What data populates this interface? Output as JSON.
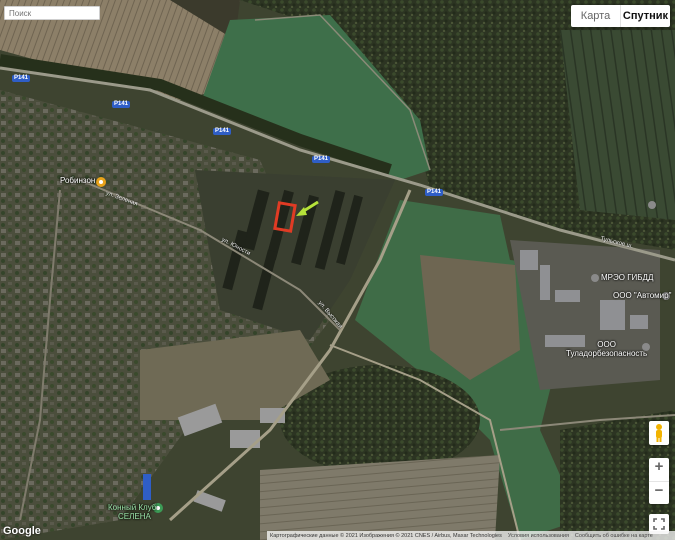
{
  "search": {
    "placeholder": "Поиск"
  },
  "map_type": {
    "map_label": "Карта",
    "satellite_label": "Спутник",
    "selected": "satellite"
  },
  "places": {
    "robinzon": "Робинзон",
    "mrez": "МРЭО ГИБДД",
    "avtomir": "ООО \"Автомир\"",
    "tula": "ООО\nТуладорбезопасность",
    "konny1": "Конный Клуб",
    "konny2": "СЕЛЕНА"
  },
  "roads": {
    "p141": "P141",
    "tulskoe": "Тульское ш.",
    "zelenaya": "ул. Зеленая",
    "yunosti": "ул. Юности",
    "vysokaya": "ул. Высокая"
  },
  "footer": {
    "attribution": "Картографические данные © 2021 Изображения © 2021 CNES / Airbus, Maxar Technologies",
    "terms": "Условия использования",
    "report": "Сообщить об ошибке на карте"
  },
  "logo": "Google",
  "zoom": {
    "in": "+",
    "out": "−"
  },
  "colors": {
    "highlight": "#e03b24",
    "arrow": "#b5e23a",
    "pin": "#e8a21a",
    "pin_green": "#3c9b56"
  }
}
